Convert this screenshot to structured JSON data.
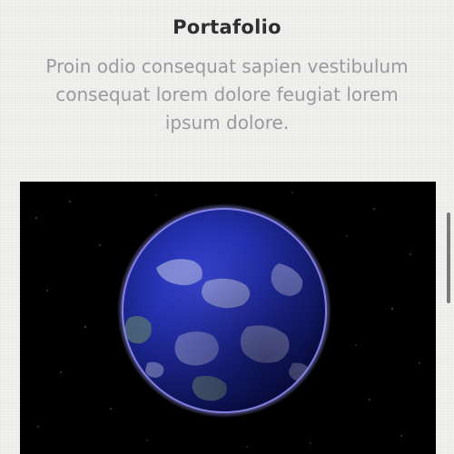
{
  "section": {
    "title": "Portafolio",
    "description": "Proin odio consequat sapien vestibulum consequat lorem dolore feugiat lorem ipsum dolore."
  },
  "media": {
    "subject": "earth-globe",
    "colors": {
      "space": "#000000",
      "ocean": "#1d2a9a",
      "rim": "#8f8cf5"
    }
  }
}
